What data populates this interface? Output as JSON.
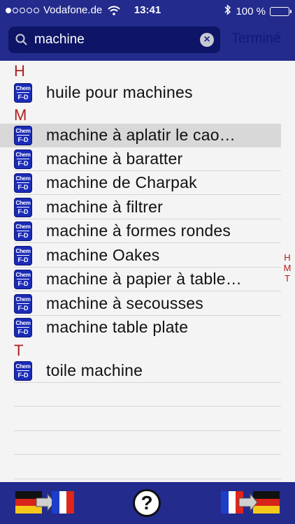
{
  "status_bar": {
    "carrier": "Vodafone.de",
    "time": "13:41",
    "battery": "100 %",
    "signal_bars_filled": 1,
    "signal_bars_total": 5
  },
  "search": {
    "query": "machine",
    "done_label": "Terminé"
  },
  "sections": [
    {
      "letter": "H",
      "items": [
        {
          "label": "huile pour machines"
        }
      ]
    },
    {
      "letter": "M",
      "items": [
        {
          "label": "machine à aplatir le cao…",
          "selected": true
        },
        {
          "label": "machine à baratter"
        },
        {
          "label": "machine de Charpak"
        },
        {
          "label": "machine à filtrer"
        },
        {
          "label": "machine à formes rondes"
        },
        {
          "label": "machine Oakes"
        },
        {
          "label": "machine à papier à table…"
        },
        {
          "label": "machine à secousses"
        },
        {
          "label": "machine table plate"
        }
      ]
    },
    {
      "letter": "T",
      "items": [
        {
          "label": "toile machine"
        }
      ]
    }
  ],
  "item_icon": {
    "line1": "Chem",
    "line2": "F-D",
    "name": "chem-dictionary-icon"
  },
  "section_index": [
    "H",
    "M",
    "T"
  ],
  "toolbar": {
    "left": "german-to-french-flag-icon",
    "center": "help-icon",
    "center_label": "?",
    "right": "french-to-german-flag-icon"
  },
  "colors": {
    "header_blue": "#232b8c",
    "search_field": "#0e1466",
    "section_red": "#b0201d",
    "icon_blue": "#1a2bb8"
  }
}
